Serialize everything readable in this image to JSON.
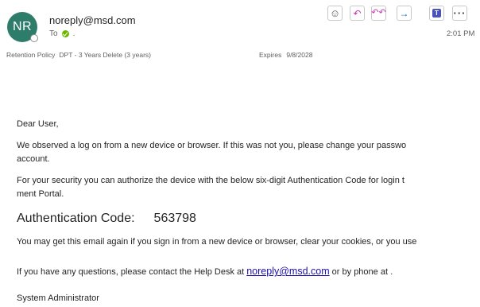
{
  "header": {
    "avatar_initials": "NR",
    "sender": "noreply@msd.com",
    "to_label": "To",
    "to_value": ".",
    "time": "2:01 PM",
    "retention_label": "Retention Policy",
    "retention_value": "DPT - 3 Years Delete (3 years)",
    "expires_label": "Expires",
    "expires_value": "9/8/2028"
  },
  "toolbar": {
    "emoji": "☺",
    "reply": "↶",
    "reply_all": "↶↶",
    "forward": "→",
    "teams": "T",
    "more": "···"
  },
  "message": {
    "greeting": "Dear User,",
    "p1_line1": "We observed a log on from a new device or browser. If this was not you, please change your passwo",
    "p1_line2": "account.",
    "p2_line1": "For your security you can authorize the device with the below six-digit Authentication Code for login t",
    "p2_line2": "ment Portal.",
    "code_label": "Authentication Code:",
    "code_value": "563798",
    "p3": "You may get this email again if you sign in from a new device or browser, clear your cookies, or you use",
    "p4_before": "If you have any questions, please contact the Help Desk at ",
    "p4_link": "noreply@msd.com",
    "p4_after": " or by phone at .",
    "signature": "System Administrator"
  },
  "colors": {
    "avatar_bg": "#2e7d6b",
    "reply_accent": "#c239b3",
    "forward_accent": "#0f6cbd",
    "teams_accent": "#4b53bc",
    "link": "#1a0dab"
  },
  "icons": [
    "emoji-icon",
    "reply-icon",
    "reply-all-icon",
    "forward-icon",
    "teams-icon",
    "more-icon",
    "presence-icon",
    "checkmark-icon"
  ]
}
